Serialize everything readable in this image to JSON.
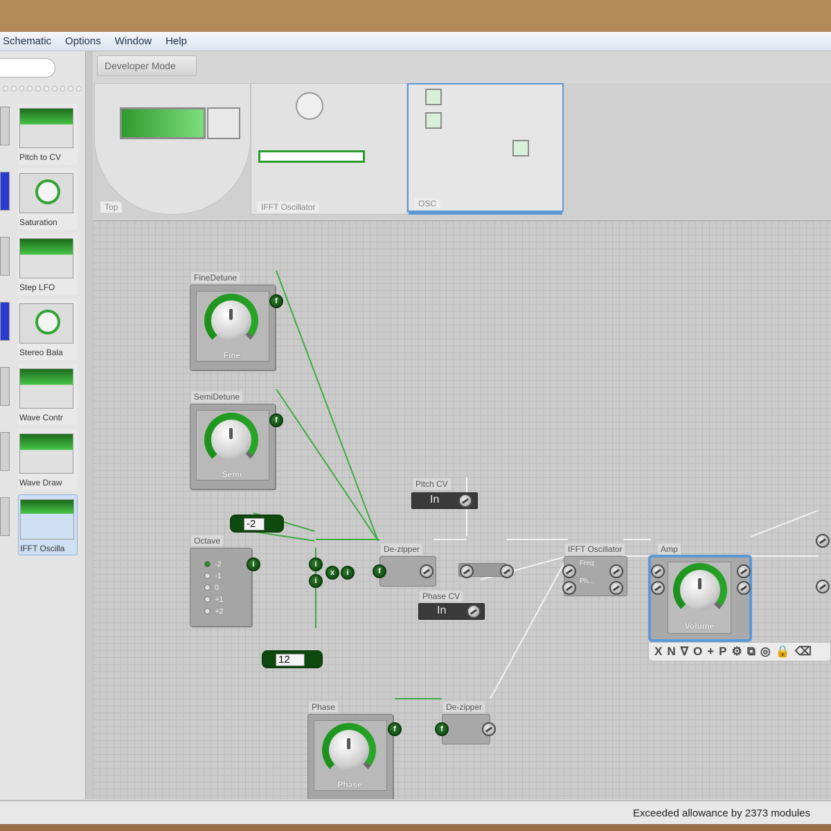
{
  "menu": [
    "Schematic",
    "Options",
    "Window",
    "Help"
  ],
  "developer_mode": "Developer Mode",
  "sidebar": {
    "tiles": [
      "Pitch to CV",
      "Saturation",
      "Step LFO",
      "Stereo Bala",
      "Wave Contr",
      "Wave Draw",
      "IFFT Oscilla"
    ]
  },
  "views": [
    "Top",
    "IFFT Oscillator",
    "OSC"
  ],
  "modules": {
    "fine_detune": {
      "title": "FineDetune",
      "knob": "Fine"
    },
    "semi_detune": {
      "title": "SemiDetune",
      "knob": "Semi"
    },
    "octave": {
      "title": "Octave",
      "options": [
        "-2",
        "-1",
        "0",
        "+1",
        "+2"
      ]
    },
    "octave_value": "-2",
    "semi_value": "12",
    "dezipper_1": "De-zipper",
    "pitch_cv": {
      "title": "Pitch CV",
      "field": "In"
    },
    "phase_cv": {
      "title": "Phase CV",
      "field": "In"
    },
    "ifft": {
      "title": "IFFT Oscillator",
      "in1": "Freq",
      "in2": "Ph..."
    },
    "amp": {
      "title": "Amp",
      "knob": "Volume"
    },
    "phase": {
      "title": "Phase",
      "knob": "Phase"
    },
    "dezipper_2": "De-zipper"
  },
  "amp_toolbar": [
    "X",
    "N",
    "∇",
    "O",
    "+",
    "P",
    "⚙",
    "⧉",
    "◎",
    "🔒",
    "⌫"
  ],
  "port_f": "f",
  "port_i": "i",
  "port_x": "x",
  "status": "Exceeded allowance by 2373 modules",
  "colors": {
    "wire": "#3faa3f",
    "wire_grey": "#f2f2f2",
    "selection": "#5d98d6"
  }
}
